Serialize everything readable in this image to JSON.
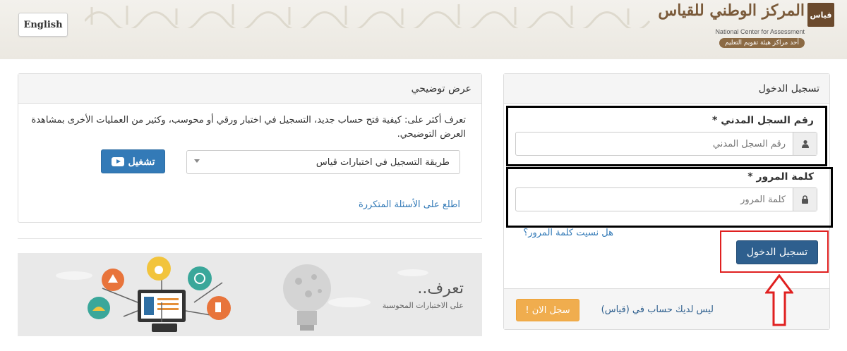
{
  "header": {
    "language_button": "English",
    "logo": {
      "arabic_name": "المركز الوطني للقياس",
      "q_mark": "قياس",
      "english_name": "National Center for Assessment",
      "tagline": "أحد مراكز هيئة تقويم التعليم"
    }
  },
  "login": {
    "title": "تسجيل الدخول",
    "national_id_label": "رقم السجل المدني *",
    "national_id_placeholder": "رقم السجل المدني",
    "password_label": "كلمة المرور *",
    "password_placeholder": "كلمة المرور",
    "forgot_password": "هل نسيت كلمة المرور؟",
    "submit_label": "تسجيل الدخول",
    "no_account_text": "ليس لديك حساب في (قياس)",
    "register_label": "سجل الان !"
  },
  "demo": {
    "title": "عرض توضيحي",
    "description": "تعرف أكثر على: كيفية فتح حساب جديد، التسجيل في اختبار ورقي أو محوسب، وكثير من العمليات الأخرى بمشاهدة العرض التوضيحي.",
    "selected_option": "طريقة التسجيل في اختبارات قياس",
    "play_label": "تشغيل",
    "faq_link": "اطلع على الأسئلة المتكررة"
  },
  "banner": {
    "title": "تعرف..",
    "subtitle": "على الاختبارات المحوسبة"
  },
  "colors": {
    "primary_button": "#2e5f8e",
    "link": "#337ab7",
    "warning_button": "#f0ad4e",
    "highlight_red": "#e02020"
  },
  "icons": {
    "user": "user-icon",
    "lock": "lock-icon",
    "play": "youtube-play-icon",
    "arrow": "up-arrow-icon"
  }
}
